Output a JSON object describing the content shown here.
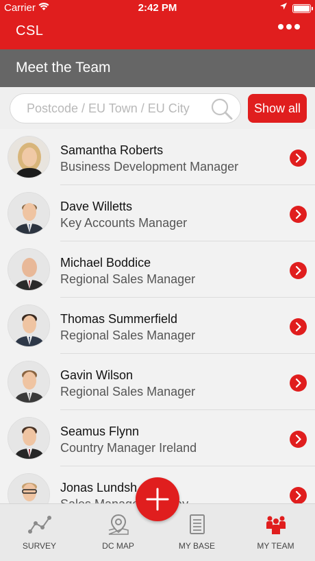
{
  "status_bar": {
    "carrier": "Carrier",
    "time": "2:42 PM"
  },
  "nav": {
    "app_title": "CSL"
  },
  "section": {
    "title": "Meet the Team"
  },
  "search": {
    "placeholder": "Postcode / EU Town / EU City",
    "value": "",
    "show_all_label": "Show all"
  },
  "team": [
    {
      "name": "Samantha Roberts",
      "role": "Business Development Manager"
    },
    {
      "name": "Dave Willetts",
      "role": "Key Accounts Manager"
    },
    {
      "name": "Michael Boddice",
      "role": "Regional Sales Manager"
    },
    {
      "name": "Thomas Summerfield",
      "role": "Regional Sales Manager"
    },
    {
      "name": "Gavin Wilson",
      "role": "Regional Sales Manager"
    },
    {
      "name": "Seamus Flynn",
      "role": "Country Manager Ireland"
    },
    {
      "name": "Jonas  Lundsh",
      "role": "Sales Manager Norway"
    }
  ],
  "tabs": [
    {
      "label": "SURVEY",
      "icon": "survey-icon"
    },
    {
      "label": "DC MAP",
      "icon": "map-pin-icon"
    },
    {
      "label": "MY BASE",
      "icon": "list-icon"
    },
    {
      "label": "MY TEAM",
      "icon": "team-icon",
      "active": true
    }
  ],
  "colors": {
    "brand_red": "#e01e1e",
    "header_gray": "#666666",
    "tab_inactive": "#8a8a8a"
  }
}
